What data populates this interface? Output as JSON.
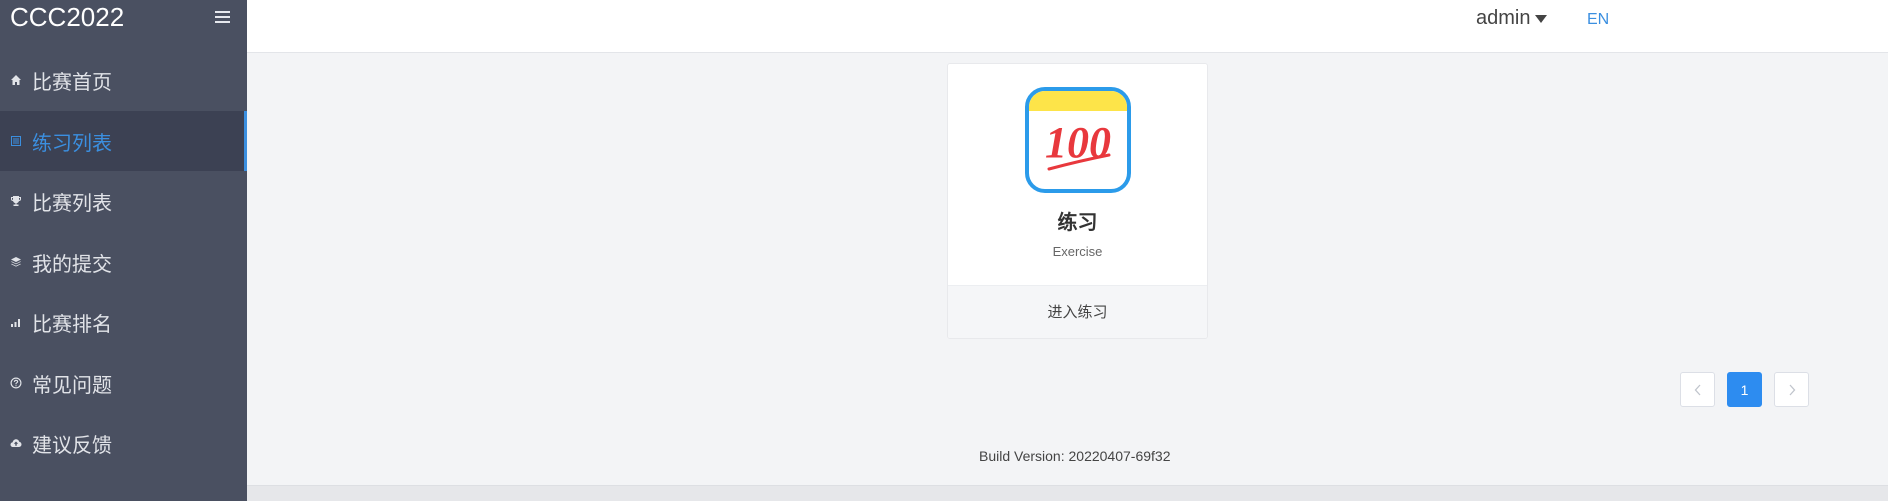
{
  "app": {
    "brand": "CCC2022"
  },
  "sidebar": {
    "items": [
      {
        "label": "比赛首页",
        "icon": "home-icon",
        "active": false
      },
      {
        "label": "练习列表",
        "icon": "list-icon",
        "active": true
      },
      {
        "label": "比赛列表",
        "icon": "trophy-icon",
        "active": false
      },
      {
        "label": "我的提交",
        "icon": "layers-icon",
        "active": false
      },
      {
        "label": "比赛排名",
        "icon": "bar-chart-icon",
        "active": false
      },
      {
        "label": "常见问题",
        "icon": "question-circle-icon",
        "active": false
      },
      {
        "label": "建议反馈",
        "icon": "cloud-upload-icon",
        "active": false
      }
    ]
  },
  "header": {
    "user": "admin",
    "lang": "EN"
  },
  "card": {
    "title": "练习",
    "subtitle": "Exercise",
    "logo_text": "100",
    "action": "进入练习"
  },
  "pagination": {
    "current": "1",
    "prev_icon": "chevron-left-icon",
    "next_icon": "chevron-right-icon"
  },
  "footer": {
    "build": "Build Version: 20220407-69f32"
  },
  "colors": {
    "sidebar_bg": "#4a5061",
    "accent": "#3b8fe0",
    "page_bg": "#f3f4f6"
  }
}
